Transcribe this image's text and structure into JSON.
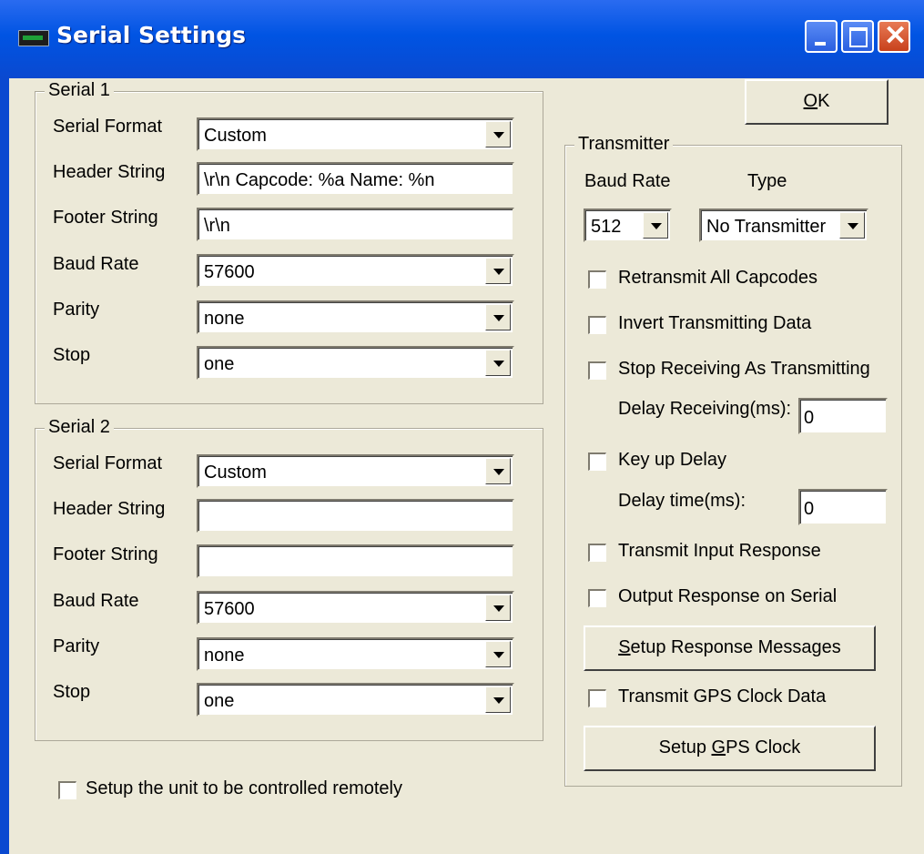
{
  "window": {
    "title": "Serial Settings"
  },
  "serial1": {
    "legend": "Serial 1",
    "serial_format": {
      "label": "Serial Format",
      "value": "Custom"
    },
    "header_string": {
      "label": "Header String",
      "value": "\\r\\n Capcode: %a Name: %n"
    },
    "footer_string": {
      "label": "Footer String",
      "value": "\\r\\n"
    },
    "baud_rate": {
      "label": "Baud Rate",
      "value": "57600"
    },
    "parity": {
      "label": "Parity",
      "value": "none"
    },
    "stop": {
      "label": "Stop",
      "value": "one"
    }
  },
  "serial2": {
    "legend": "Serial 2",
    "serial_format": {
      "label": "Serial Format",
      "value": "Custom"
    },
    "header_string": {
      "label": "Header String",
      "value": ""
    },
    "footer_string": {
      "label": "Footer String",
      "value": ""
    },
    "baud_rate": {
      "label": "Baud Rate",
      "value": "57600"
    },
    "parity": {
      "label": "Parity",
      "value": "none"
    },
    "stop": {
      "label": "Stop",
      "value": "one"
    }
  },
  "remote_control": {
    "label": "Setup the unit to be controlled remotely",
    "checked": false
  },
  "ok_button": {
    "accel": "O",
    "rest": "K"
  },
  "transmitter": {
    "legend": "Transmitter",
    "baud_rate_label": "Baud Rate",
    "type_label": "Type",
    "baud_rate_value": "512",
    "type_value": "No Transmitter",
    "retransmit_all": "Retransmit All Capcodes",
    "invert_data": "Invert Transmitting Data",
    "stop_receiving": "Stop Receiving As Transmitting",
    "delay_receiving_label": "Delay Receiving(ms):",
    "delay_receiving_value": "0",
    "key_up_delay": "Key up Delay",
    "delay_time_label": "Delay time(ms):",
    "delay_time_value": "0",
    "transmit_input_response": "Transmit Input Response",
    "output_response_serial": "Output Response on Serial",
    "setup_response_btn": {
      "accel": "S",
      "rest": "etup Response Messages"
    },
    "transmit_gps": "Transmit GPS Clock Data",
    "setup_gps_btn": {
      "pre": "Setup ",
      "accel": "G",
      "rest": "PS Clock"
    }
  }
}
